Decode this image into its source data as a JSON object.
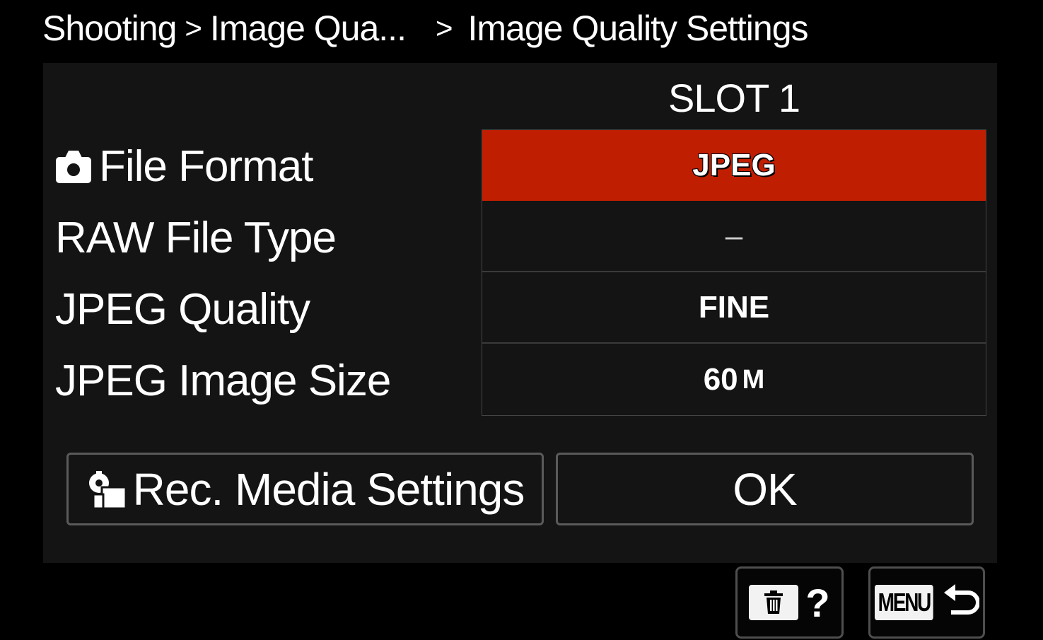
{
  "breadcrumb": {
    "level1": "Shooting",
    "sep1": ">",
    "level2": "Image Qua...",
    "sep2": ">",
    "current": "Image Quality Settings"
  },
  "slot_header": "SLOT 1",
  "settings": [
    {
      "label": "File Format",
      "value": "JPEG",
      "selected": true,
      "icon": "camera-icon"
    },
    {
      "label": "RAW File Type",
      "value": "–",
      "selected": false
    },
    {
      "label": "JPEG Quality",
      "value": "FINE",
      "selected": false
    },
    {
      "label": "JPEG Image Size",
      "value": "60",
      "unit": "M",
      "selected": false
    }
  ],
  "buttons": {
    "rec_media": "Rec. Media Settings",
    "rec_media_icon": "media-settings-icon",
    "ok": "OK"
  },
  "key_hints": {
    "delete_help_label": "?",
    "delete_icon": "trash-icon",
    "menu_label": "MENU",
    "back_icon": "return-arrow-icon"
  },
  "colors": {
    "selected_bg": "#c01e00",
    "panel_bg": "#141414",
    "page_bg": "#000000"
  }
}
